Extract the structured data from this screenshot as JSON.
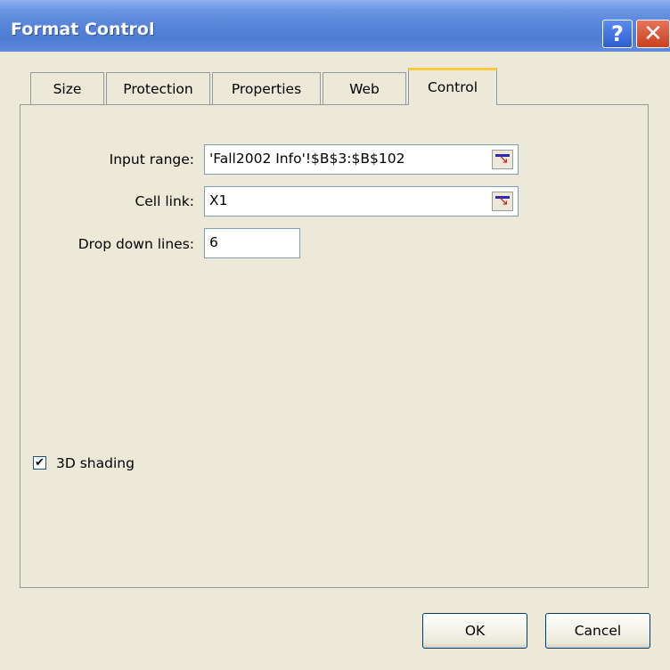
{
  "window": {
    "title": "Format Control",
    "help_glyph": "?",
    "close_glyph": "✕"
  },
  "tabs": [
    {
      "label": "Size"
    },
    {
      "label": "Protection"
    },
    {
      "label": "Properties"
    },
    {
      "label": "Web"
    },
    {
      "label": "Control",
      "active": true
    }
  ],
  "form": {
    "input_range": {
      "label": "Input range:",
      "value": "'Fall2002 Info'!$B$3:$B$102"
    },
    "cell_link": {
      "label": "Cell link:",
      "value": "X1"
    },
    "drop_down_lines": {
      "label": "Drop down lines:",
      "value": "6"
    },
    "shading": {
      "label": "3D shading",
      "checked": true,
      "check_glyph": "✔"
    }
  },
  "buttons": {
    "ok": "OK",
    "cancel": "Cancel"
  }
}
